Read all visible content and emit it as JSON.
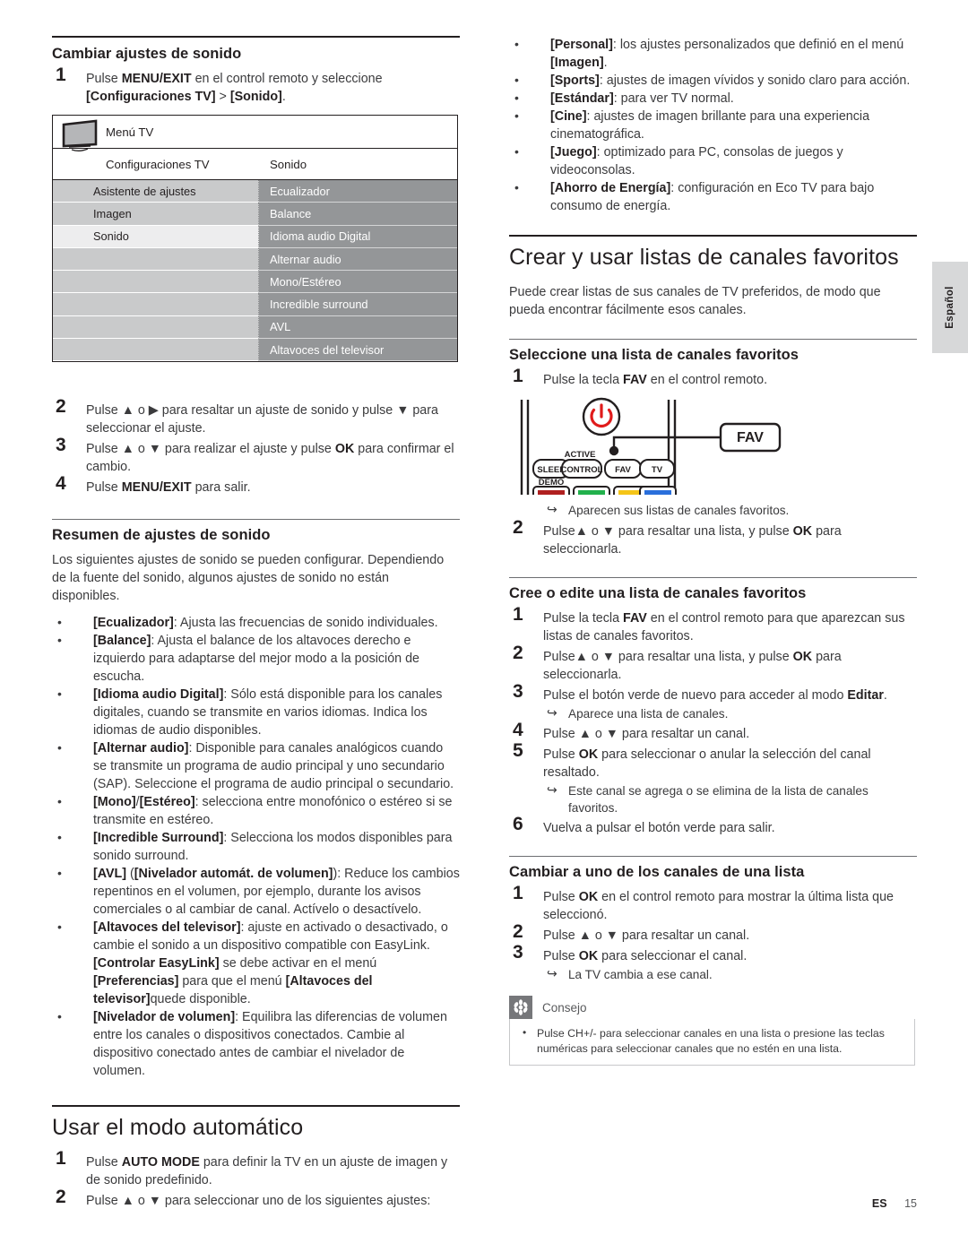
{
  "page": {
    "language_tab": "Español",
    "footer_code": "ES",
    "footer_page": "15"
  },
  "left_column": {
    "section_sound_settings": {
      "heading": "Cambiar ajustes de sonido",
      "step1_pre": "Pulse ",
      "step1_bold": "MENU/EXIT",
      "step1_post": " en el control remoto y seleccione [Configuraciones TV] > [Sonido].",
      "step1_full": "Pulse MENU/EXIT en el control remoto y seleccione [Configuraciones TV] > [Sonido]."
    },
    "tv_menu_graphic": {
      "icon_name": "tv-screen-icon",
      "title": "Menú TV",
      "column_a_header": "Configuraciones TV",
      "column_b_header": "Sonido",
      "column_a_items": [
        "Asistente de ajustes",
        "Imagen",
        "Sonido",
        "",
        "",
        "",
        "",
        ""
      ],
      "column_a_selected_index": 2,
      "column_b_items": [
        "Ecualizador",
        "Balance",
        "Idioma audio Digital",
        "Alternar audio",
        "Mono/Estéreo",
        "Incredible surround",
        "AVL",
        "Altavoces del televisor"
      ]
    },
    "steps_after_menu": [
      "Pulse ▲ o ▶ para resaltar un ajuste de sonido y pulse ▼ para seleccionar el ajuste.",
      "Pulse ▲ o ▼ para realizar el ajuste y pulse OK para confirmar el cambio.",
      "Pulse MENU/EXIT para salir."
    ],
    "section_summary": {
      "heading": "Resumen de ajustes de sonido",
      "intro": "Los siguientes ajustes de sonido se pueden configurar. Dependiendo de la fuente del sonido, algunos ajustes de sonido no están disponibles.",
      "bullets": [
        "[Ecualizador]: Ajusta las frecuencias de sonido individuales.",
        "[Balance]: Ajusta el balance de los altavoces derecho e izquierdo para adaptarse del mejor modo a la posición de escucha.",
        "[Idioma audio Digital]: Sólo está disponible para los canales digitales, cuando se transmite en varios idiomas. Indica los idiomas de audio disponibles.",
        "[Alternar audio]: Disponible para canales analógicos cuando se transmite un programa de audio principal y uno secundario (SAP). Seleccione el programa de audio principal o secundario.",
        "[Mono]/[Estéreo]: selecciona entre monofónico o estéreo si se transmite en estéreo.",
        "[Incredible Surround]: Selecciona los modos disponibles para sonido surround.",
        "[AVL] ([Nivelador automát. de volumen]): Reduce los cambios repentinos en el volumen, por ejemplo, durante los avisos comerciales o al cambiar de canal. Actívelo o desactívelo.",
        "[Altavoces del televisor]: ajuste en activado o desactivado, o cambie el sonido a un dispositivo compatible con EasyLink. [Controlar EasyLink] se debe activar en el menú [Preferencias] para que el menú [Altavoces del televisor]quede disponible.",
        "[Nivelador de volumen]: Equilibra las diferencias de volumen entre los canales o dispositivos conectados. Cambie al dispositivo conectado antes de cambiar el nivelador de volumen."
      ]
    },
    "section_auto_mode": {
      "heading": "Usar el modo automático",
      "steps": [
        "Pulse AUTO MODE para definir la TV en un ajuste de imagen y de sonido predefinido.",
        "Pulse ▲ o ▼ para seleccionar uno de los siguientes ajustes:"
      ]
    }
  },
  "right_column": {
    "auto_mode_bullets": [
      "[Personal]: los ajustes personalizados que definió en el menú [Imagen].",
      "[Sports]: ajustes de imagen vívidos y sonido claro para acción.",
      "[Estándar]: para ver TV normal.",
      "[Cine]: ajustes de imagen brillante para una experiencia cinematográfica.",
      "[Juego]: optimizado para PC, consolas de juegos y videoconsolas.",
      "[Ahorro de Energía]: configuración en Eco TV para bajo consumo de energía."
    ],
    "section_favorites": {
      "heading": "Crear y usar listas de canales favoritos",
      "intro": "Puede crear listas de sus canales de TV  preferidos, de modo que pueda encontrar fácilmente esos canales."
    },
    "section_select_list": {
      "heading": "Seleccione una lista de canales favoritos",
      "step1": "Pulse la tecla FAV en el control remoto.",
      "note1": "Aparecen sus listas de canales favoritos.",
      "step2": "Pulse▲ o ▼ para resaltar una lista, y pulse OK para seleccionarla."
    },
    "remote_graphic": {
      "callout_label": "FAV",
      "power_icon": "power-icon",
      "buttons": [
        {
          "label": "SLEEP",
          "sublabel": "DEMO",
          "color_name": "red-color-button",
          "color": "#b02020"
        },
        {
          "label": "CONTROL",
          "toplabel": "ACTIVE",
          "color_name": "green-color-button",
          "color": "#22b14c"
        },
        {
          "label": "FAV",
          "color_name": "yellow-color-button",
          "color": "#f5c518"
        },
        {
          "label": "TV",
          "color_name": "blue-color-button",
          "color": "#2a6fdb"
        }
      ]
    },
    "section_create_edit": {
      "heading": "Cree o edite una lista de canales favoritos",
      "steps": [
        "Pulse la tecla FAV en el control remoto para que aparezcan sus listas de canales favoritos.",
        "Pulse▲ o ▼ para resaltar una lista, y pulse OK para seleccionarla.",
        "Pulse el botón verde de nuevo para acceder al modo Editar.",
        "Pulse ▲ o ▼ para resaltar un canal.",
        "Pulse OK para seleccionar o anular la selección del canal resaltado.",
        "Vuelva a pulsar el botón verde para salir."
      ],
      "note_step3": "Aparece una lista de canales.",
      "note_step5": "Este canal se agrega o se elimina de la lista de canales favoritos."
    },
    "section_change_channel": {
      "heading": "Cambiar a uno de los canales de una lista",
      "steps": [
        "Pulse OK en el control remoto para mostrar la última lista que seleccionó.",
        "Pulse ▲ o ▼ para resaltar un canal.",
        "Pulse OK para seleccionar el canal."
      ],
      "note_step3": "La TV cambia a ese canal."
    },
    "tip": {
      "icon_name": "asterisk-tip-icon",
      "title": "Consejo",
      "bullets": [
        "Pulse CH+/- para seleccionar canales en una lista o presione las teclas numéricas para seleccionar canales que no estén en una lista."
      ]
    }
  },
  "colors": {
    "text": "#3b3b3d",
    "heading": "#231f20",
    "menu_gray_light": "#c9cacb",
    "menu_gray_dark": "#949698",
    "menu_selected": "#ededee",
    "tab_gray": "#d7d8d9",
    "tip_icon_bg": "#76777a"
  }
}
